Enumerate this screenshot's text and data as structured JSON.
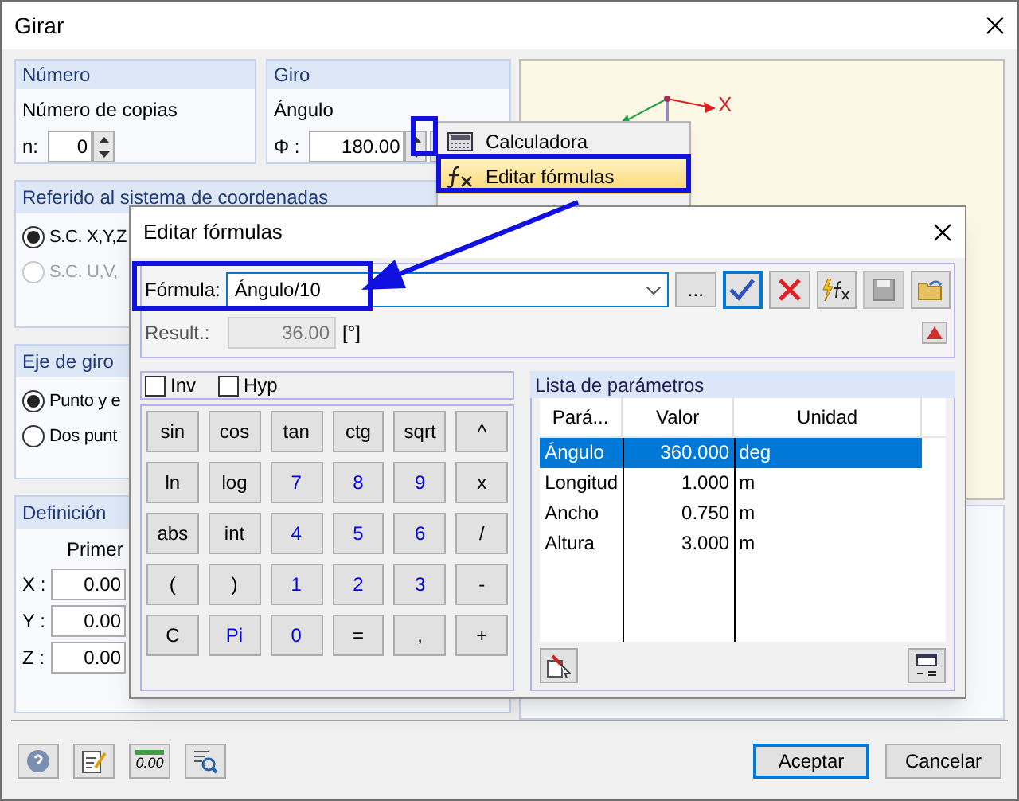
{
  "window": {
    "title": "Girar"
  },
  "numero": {
    "title": "Número",
    "label": "Número de copias",
    "field_label": "n:",
    "value": "0"
  },
  "giro": {
    "title": "Giro",
    "label": "Ángulo",
    "field_label": "Φ :",
    "value": "180.00"
  },
  "coord_system": {
    "title": "Referido al sistema de coordenadas",
    "options": [
      {
        "label": "S.C. X,Y,Z",
        "selected": true,
        "disabled": false
      },
      {
        "label": "S.C. U,V,",
        "selected": false,
        "disabled": true
      }
    ]
  },
  "rotation_axis": {
    "title": "Eje de giro",
    "options": [
      {
        "label": "Punto y e",
        "selected": true,
        "disabled": false
      },
      {
        "label": "Dos punt",
        "selected": false,
        "disabled": false
      }
    ]
  },
  "axis_definition": {
    "title": "Definición",
    "column": "Primer",
    "rows": [
      {
        "label": "X :",
        "value": "0.00"
      },
      {
        "label": "Y :",
        "value": "0.00"
      },
      {
        "label": "Z :",
        "value": "0.00"
      }
    ]
  },
  "preview": {
    "axis_label": "X"
  },
  "context_menu": {
    "items": [
      {
        "label": "Calculadora",
        "kind": "calculator",
        "selected": false
      },
      {
        "label": "Editar fórmulas",
        "kind": "formula",
        "selected": true
      }
    ]
  },
  "formula_dialog": {
    "title": "Editar fórmulas",
    "formula_label": "Fórmula:",
    "formula": "Ángulo/10",
    "more_button": "...",
    "result_label": "Result.:",
    "result": "36.00",
    "result_unit": "[°]",
    "checkboxes": [
      {
        "label": "Inv",
        "checked": false
      },
      {
        "label": "Hyp",
        "checked": false
      }
    ],
    "keypad": [
      {
        "label": "sin",
        "kind": "function"
      },
      {
        "label": "cos",
        "kind": "function"
      },
      {
        "label": "tan",
        "kind": "function"
      },
      {
        "label": "ctg",
        "kind": "function"
      },
      {
        "label": "sqrt",
        "kind": "function"
      },
      {
        "label": "^",
        "kind": "operator"
      },
      {
        "label": "ln",
        "kind": "function"
      },
      {
        "label": "log",
        "kind": "function"
      },
      {
        "label": "7",
        "kind": "number"
      },
      {
        "label": "8",
        "kind": "number"
      },
      {
        "label": "9",
        "kind": "number"
      },
      {
        "label": "x",
        "kind": "operator"
      },
      {
        "label": "abs",
        "kind": "function"
      },
      {
        "label": "int",
        "kind": "function"
      },
      {
        "label": "4",
        "kind": "number"
      },
      {
        "label": "5",
        "kind": "number"
      },
      {
        "label": "6",
        "kind": "number"
      },
      {
        "label": "/",
        "kind": "operator"
      },
      {
        "label": "(",
        "kind": "operator"
      },
      {
        "label": ")",
        "kind": "operator"
      },
      {
        "label": "1",
        "kind": "number"
      },
      {
        "label": "2",
        "kind": "number"
      },
      {
        "label": "3",
        "kind": "number"
      },
      {
        "label": "-",
        "kind": "operator"
      },
      {
        "label": "C",
        "kind": "operator"
      },
      {
        "label": "Pi",
        "kind": "number"
      },
      {
        "label": "0",
        "kind": "number"
      },
      {
        "label": "=",
        "kind": "operator"
      },
      {
        "label": ",",
        "kind": "operator"
      },
      {
        "label": "+",
        "kind": "operator"
      }
    ],
    "parameters": {
      "title": "Lista de parámetros",
      "columns": [
        "Pará...",
        "Valor",
        "Unidad"
      ],
      "rows": [
        {
          "name": "Ángulo",
          "value": "360.000",
          "unit": "deg",
          "selected": true
        },
        {
          "name": "Longitud",
          "value": "1.000",
          "unit": "m",
          "selected": false
        },
        {
          "name": "Ancho",
          "value": "0.750",
          "unit": "m",
          "selected": false
        },
        {
          "name": "Altura",
          "value": "3.000",
          "unit": "m",
          "selected": false
        }
      ]
    }
  },
  "footer_tools": [
    {
      "kind": "help"
    },
    {
      "kind": "edit"
    },
    {
      "kind": "units",
      "label": "0.00"
    },
    {
      "kind": "search"
    }
  ],
  "footer_buttons": [
    {
      "label": "Aceptar",
      "default": true
    },
    {
      "label": "Cancelar",
      "default": false
    }
  ]
}
